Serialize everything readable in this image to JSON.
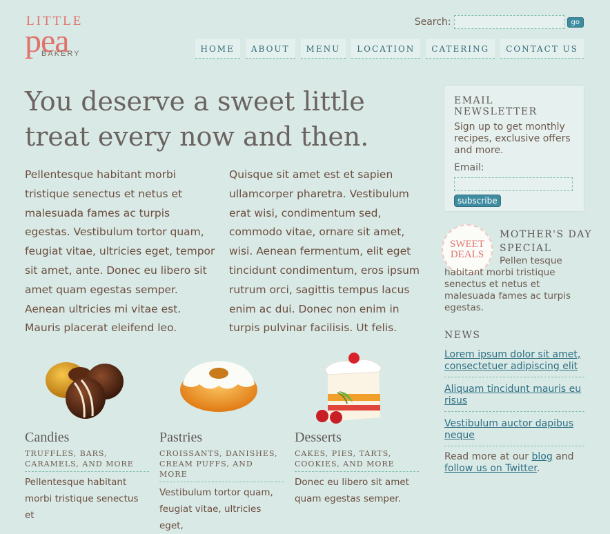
{
  "logo": {
    "line1": "LITTLE",
    "line2": "pea",
    "line3": "BAKERY"
  },
  "search": {
    "label": "Search:",
    "button": "go",
    "value": ""
  },
  "nav": [
    "HOME",
    "ABOUT",
    "MENU",
    "LOCATION",
    "CATERING",
    "CONTACT US"
  ],
  "main": {
    "headline": "You deserve a sweet little treat every now and then.",
    "col_left": "Pellentesque habitant morbi tristique senectus et netus et malesuada fames ac turpis egestas. Vestibulum tortor quam, feugiat vitae, ultricies eget, tempor sit amet, ante. Donec eu libero sit amet quam egestas semper. Aenean ultricies mi vitae est. Mauris placerat eleifend leo.",
    "col_right": "Quisque sit amet est et sapien ullamcorper pharetra. Vestibulum erat wisi, condimentum sed, commodo vitae, ornare sit amet, wisi. Aenean fermentum, elit eget tincidunt condimentum, eros ipsum rutrum orci, sagittis tempus lacus enim ac dui. Donec non enim in turpis pulvinar facilisis. Ut felis."
  },
  "products": [
    {
      "icon": "chocolate-candies-icon",
      "title": "Candies",
      "sub1": "TRUFFLES, BARS,",
      "sub2": "CARAMELS, AND MORE",
      "desc": "Pellentesque habitant morbi tristique senectus et"
    },
    {
      "icon": "bundt-cake-icon",
      "title": "Pastries",
      "sub1": "CROISSANTS, DANISHES,",
      "sub2": "CREAM PUFFS, AND MORE",
      "desc": "Vestibulum tortor quam, feugiat vitae, ultricies eget,"
    },
    {
      "icon": "cake-slice-icon",
      "title": "Desserts",
      "sub1": "CAKES, PIES, TARTS,",
      "sub2": "COOKIES, AND MORE",
      "desc": "Donec eu libero sit amet quam egestas semper."
    }
  ],
  "sidebar": {
    "newsletter": {
      "title": "EMAIL NEWSLETTER",
      "text": "Sign up to get monthly recipes, exclusive offers and more.",
      "email_label": "Email:",
      "email_value": "",
      "subscribe": "subscribe"
    },
    "badge": {
      "line1": "SWEET",
      "line2": "DEALS"
    },
    "special": {
      "title1": "MOTHER'S DAY",
      "title2": "SPECIAL",
      "text": "Pellen tesque habitant morbi tristique senectus et netus et malesuada fames ac turpis egestas."
    },
    "news_title": "NEWS",
    "news": [
      "Lorem ipsum dolor sit amet, consectetuer adipiscing elit",
      "Aliquam tincidunt mauris eu risus",
      "Vestibulum auctor dapibus neque"
    ],
    "footer": {
      "pre": "Read more at our ",
      "blog": "blog",
      "and": " and",
      "twitter": "follow us on Twitter",
      "end": "."
    }
  },
  "colors": {
    "background": "#d9e9e6",
    "accent": "#e0736c",
    "link": "#2d6f83",
    "button": "#3f8ca0"
  }
}
